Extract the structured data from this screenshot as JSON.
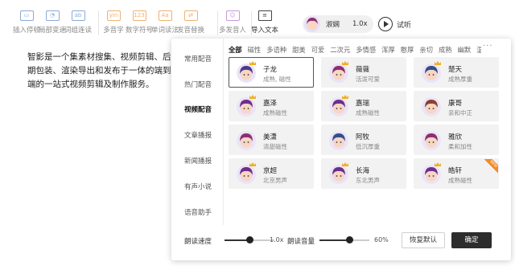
{
  "toolbar": {
    "tools": [
      {
        "label": "插入停顿",
        "icon": "pause-icon",
        "glyph": "▭",
        "color": "blue"
      },
      {
        "label": "局部变速",
        "icon": "speed-icon",
        "glyph": "◔",
        "color": "blue"
      },
      {
        "label": "词组连读",
        "icon": "phrase-icon",
        "glyph": "ab",
        "color": "blue"
      },
      {
        "label": "多音字",
        "icon": "polyphone-icon",
        "glyph": "yin",
        "color": "orange"
      },
      {
        "label": "数字符号",
        "icon": "number-icon",
        "glyph": "123",
        "color": "orange"
      },
      {
        "label": "单词读法",
        "icon": "word-icon",
        "glyph": "Aa",
        "color": "orange"
      },
      {
        "label": "发音替换",
        "icon": "replace-icon",
        "glyph": "⇄",
        "color": "orange"
      },
      {
        "label": "多发音人",
        "icon": "multi-speaker-icon",
        "glyph": "☺",
        "color": "purple"
      },
      {
        "label": "导入文本",
        "icon": "import-text-icon",
        "glyph": "≡",
        "color": "dark"
      }
    ],
    "current_voice": "淑娴",
    "current_speed": "1.0x",
    "try_label": "试听"
  },
  "editor": {
    "text": "智影是一个集素材搜集、视频剪辑、后期包装、渲染导出和发布于一体的端到端的一站式视频剪辑及制作服务。"
  },
  "panel": {
    "nav": [
      {
        "label": "常用配音",
        "active": false
      },
      {
        "label": "热门配音",
        "active": false
      },
      {
        "label": "视频配音",
        "active": true
      },
      {
        "label": "文章播报",
        "active": false
      },
      {
        "label": "新闻播报",
        "active": false
      },
      {
        "label": "有声小说",
        "active": false
      },
      {
        "label": "语音助手",
        "active": false
      }
    ],
    "filters": [
      "全部",
      "磁性",
      "多语种",
      "甜美",
      "可爱",
      "二次元",
      "多情感",
      "浑厚",
      "憨厚",
      "亲切",
      "成熟",
      "幽默",
      "温"
    ],
    "more": "···",
    "voices": [
      {
        "name": "子龙",
        "tags": "成熟, 磁性",
        "selected": true,
        "crown": true,
        "hair": "#4a3b8c",
        "badge": false
      },
      {
        "name": "薇薇",
        "tags": "活泼可爱",
        "selected": false,
        "crown": true,
        "hair": "#8c2f6f",
        "badge": false
      },
      {
        "name": "楚天",
        "tags": "成熟厚重",
        "selected": false,
        "crown": true,
        "hair": "#2f4f8c",
        "badge": false
      },
      {
        "name": "嘉泽",
        "tags": "成熟磁性",
        "selected": false,
        "crown": true,
        "hair": "#6b2f8c",
        "badge": false
      },
      {
        "name": "嘉瑞",
        "tags": "成熟磁性",
        "selected": false,
        "crown": true,
        "hair": "#6b2f8c",
        "badge": false
      },
      {
        "name": "康哥",
        "tags": "亲和中正",
        "selected": false,
        "crown": false,
        "hair": "#8c3f2f",
        "badge": false
      },
      {
        "name": "美潇",
        "tags": "清甜磁性",
        "selected": false,
        "crown": false,
        "hair": "#8c2f6f",
        "badge": false
      },
      {
        "name": "阿牧",
        "tags": "低沉厚重",
        "selected": false,
        "crown": false,
        "hair": "#2f4f8c",
        "badge": false
      },
      {
        "name": "雅欣",
        "tags": "柔和加性",
        "selected": false,
        "crown": false,
        "hair": "#8c2f6f",
        "badge": false
      },
      {
        "name": "京超",
        "tags": "北京男声",
        "selected": false,
        "crown": true,
        "hair": "#6b2f8c",
        "badge": false
      },
      {
        "name": "长海",
        "tags": "东北男声",
        "selected": false,
        "crown": true,
        "hair": "#6b2f8c",
        "badge": false
      },
      {
        "name": "皓轩",
        "tags": "成熟磁性",
        "selected": false,
        "crown": true,
        "hair": "#6b2f8c",
        "badge": true
      }
    ],
    "badge_text": "NEW",
    "speed_label": "朗读速度",
    "speed_value": "1.0x",
    "speed_level": 0.5,
    "volume_label": "朗读音量",
    "volume_value": "60%",
    "volume_level": 0.6,
    "reset_label": "恢复默认",
    "ok_label": "确定"
  }
}
